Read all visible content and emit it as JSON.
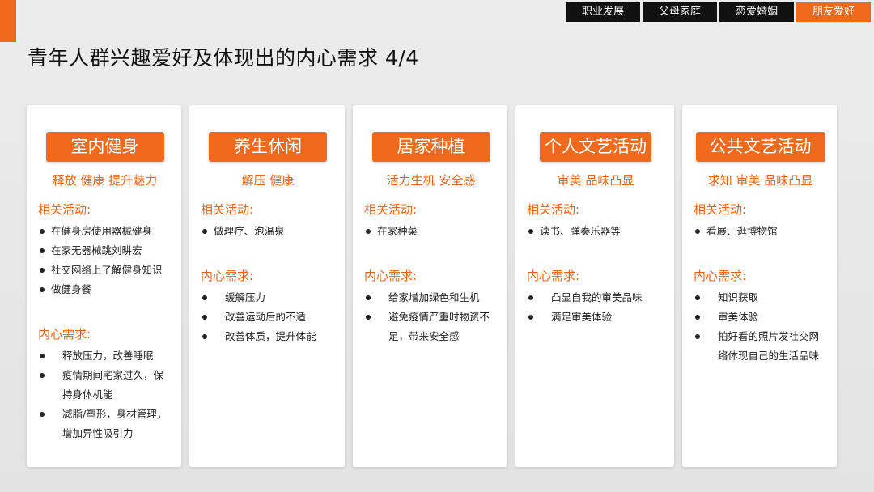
{
  "nav": {
    "tabs": [
      {
        "label": "职业发展",
        "active": false
      },
      {
        "label": "父母家庭",
        "active": false
      },
      {
        "label": "恋爱婚姻",
        "active": false
      },
      {
        "label": "朋友爱好",
        "active": true
      }
    ]
  },
  "page": {
    "title": "青年人群兴趣爱好及体现出的内心需求 4/4"
  },
  "colors": {
    "accent": "#f06a1e",
    "tab_bg": "#111111",
    "background": "#e8e8e8"
  },
  "cards": [
    {
      "title": "室内健身",
      "keywords": "释放 健康 提升魅力",
      "activities_label": "相关活动:",
      "activities": [
        "在健身房使用器械健身",
        "在家无器械跳刘畊宏",
        "社交网络上了解健身知识",
        "做健身餐"
      ],
      "needs_label": "内心需求:",
      "needs": [
        "释放压力，改善睡眠",
        "疫情期间宅家过久，保持身体机能",
        "减脂/塑形，身材管理，增加异性吸引力"
      ]
    },
    {
      "title": "养生休闲",
      "keywords": "解压 健康",
      "activities_label": "相关活动:",
      "activities": [
        "做理疗、泡温泉"
      ],
      "needs_label": "内心需求:",
      "needs": [
        "缓解压力",
        "改善运动后的不适",
        "改善体质，提升体能"
      ]
    },
    {
      "title": "居家种植",
      "keywords": "活力生机 安全感",
      "activities_label": "相关活动:",
      "activities": [
        "在家种菜"
      ],
      "needs_label": "内心需求:",
      "needs": [
        "给家增加绿色和生机",
        "避免疫情严重时物资不足，带来安全感"
      ]
    },
    {
      "title": "个人文艺活动",
      "keywords": "审美 品味凸显",
      "activities_label": "相关活动:",
      "activities": [
        "读书、弹奏乐器等"
      ],
      "needs_label": "内心需求:",
      "needs": [
        "凸显自我的审美品味",
        "满足审美体验"
      ]
    },
    {
      "title": "公共文艺活动",
      "keywords": "求知 审美 品味凸显",
      "activities_label": "相关活动:",
      "activities": [
        "看展、逛博物馆"
      ],
      "needs_label": "内心需求:",
      "needs": [
        "知识获取",
        "审美体验",
        "拍好看的照片发社交网络体现自己的生活品味"
      ]
    }
  ]
}
